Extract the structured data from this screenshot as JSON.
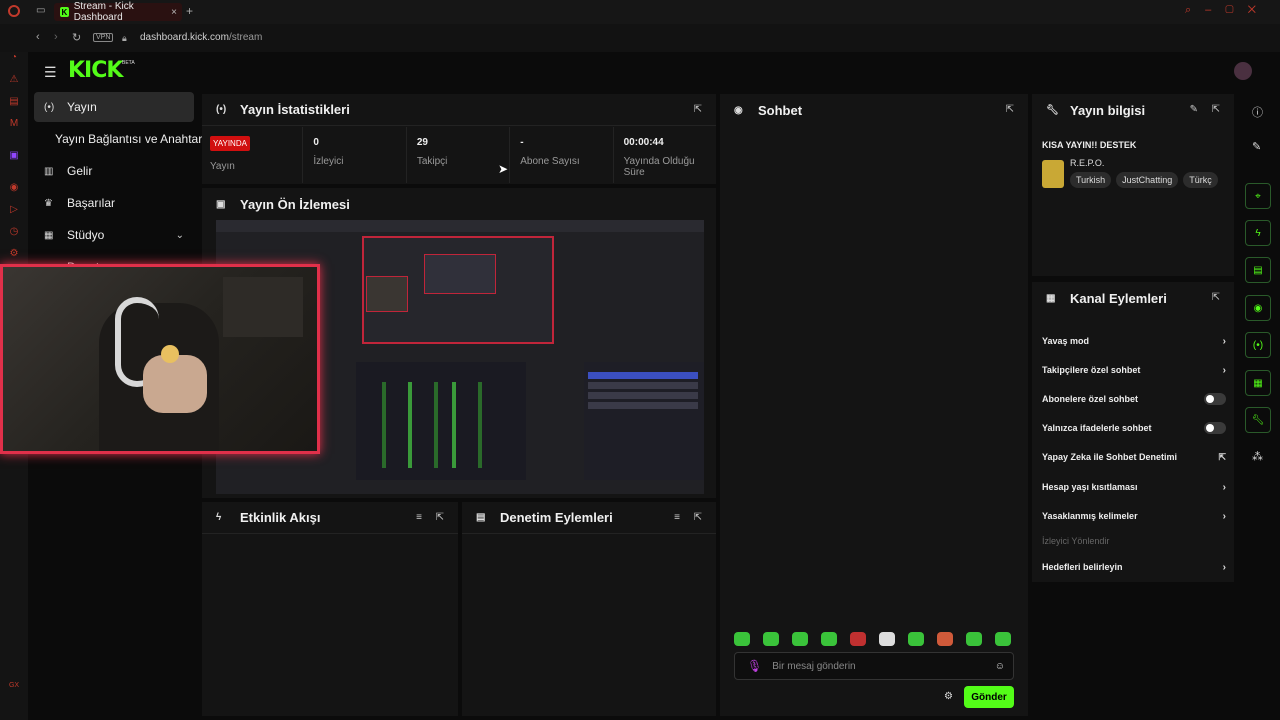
{
  "browser": {
    "tab_title": "Stream - Kick Dashboard",
    "url_domain": "dashboard.kick.com",
    "url_path": "/stream",
    "vpn_label": "VPN",
    "ai_label": "AI"
  },
  "header": {
    "logo": "KICK",
    "beta": "BETA"
  },
  "sidebar": {
    "items": [
      {
        "label": "Yayın",
        "icon": "broadcast-icon"
      },
      {
        "label": "Yayın Bağlantısı ve Anahtarı",
        "icon": ""
      },
      {
        "label": "Gelir",
        "icon": "chart-icon"
      },
      {
        "label": "Başarılar",
        "icon": "trophy-icon"
      },
      {
        "label": "Stüdyo",
        "icon": "studio-icon"
      },
      {
        "label": "Denet",
        "icon": "moderation-icon"
      }
    ]
  },
  "stats_panel": {
    "title": "Yayın İstatistikleri",
    "live_badge": "YAYINDA",
    "stats": [
      {
        "value": "",
        "label": "Yayın"
      },
      {
        "value": "0",
        "label": "İzleyici"
      },
      {
        "value": "29",
        "label": "Takipçi"
      },
      {
        "value": "-",
        "label": "Abone Sayısı"
      },
      {
        "value": "00:00:44",
        "label": "Yayında Olduğu Süre"
      }
    ]
  },
  "preview_panel": {
    "title": "Yayın Ön İzlemesi"
  },
  "activity_panel": {
    "title": "Etkinlik Akışı"
  },
  "moderation_panel": {
    "title": "Denetim Eylemleri"
  },
  "chat_panel": {
    "title": "Sohbet",
    "input_placeholder": "Bir mesaj gönderin",
    "send_label": "Gönder"
  },
  "stream_info": {
    "title": "Yayın bilgisi",
    "stream_title": "KISA YAYIN!! DESTEK",
    "game": "R.E.P.O.",
    "tags": [
      "Turkish",
      "JustChatting",
      "Türkç"
    ]
  },
  "channel_actions": {
    "title": "Kanal Eylemleri",
    "items": [
      {
        "label": "Yavaş mod",
        "control": "chevron"
      },
      {
        "label": "Takipçilere özel sohbet",
        "control": "chevron"
      },
      {
        "label": "Abonelere özel sohbet",
        "control": "toggle"
      },
      {
        "label": "Yalnızca ifadelerle sohbet",
        "control": "toggle"
      },
      {
        "label": "Yapay Zeka ile Sohbet Denetimi",
        "control": "external"
      },
      {
        "label": "Hesap yaşı kısıtlaması",
        "control": "chevron"
      },
      {
        "label": "Yasaklanmış kelimeler",
        "control": "chevron"
      },
      {
        "label": "İzleyici Yönlendir",
        "control": "disabled"
      },
      {
        "label": "Hedefleri belirleyin",
        "control": "chevron"
      }
    ]
  },
  "colors": {
    "brand": "#53fc18",
    "live": "#d10f0f",
    "webcam_border": "#e0304a"
  }
}
